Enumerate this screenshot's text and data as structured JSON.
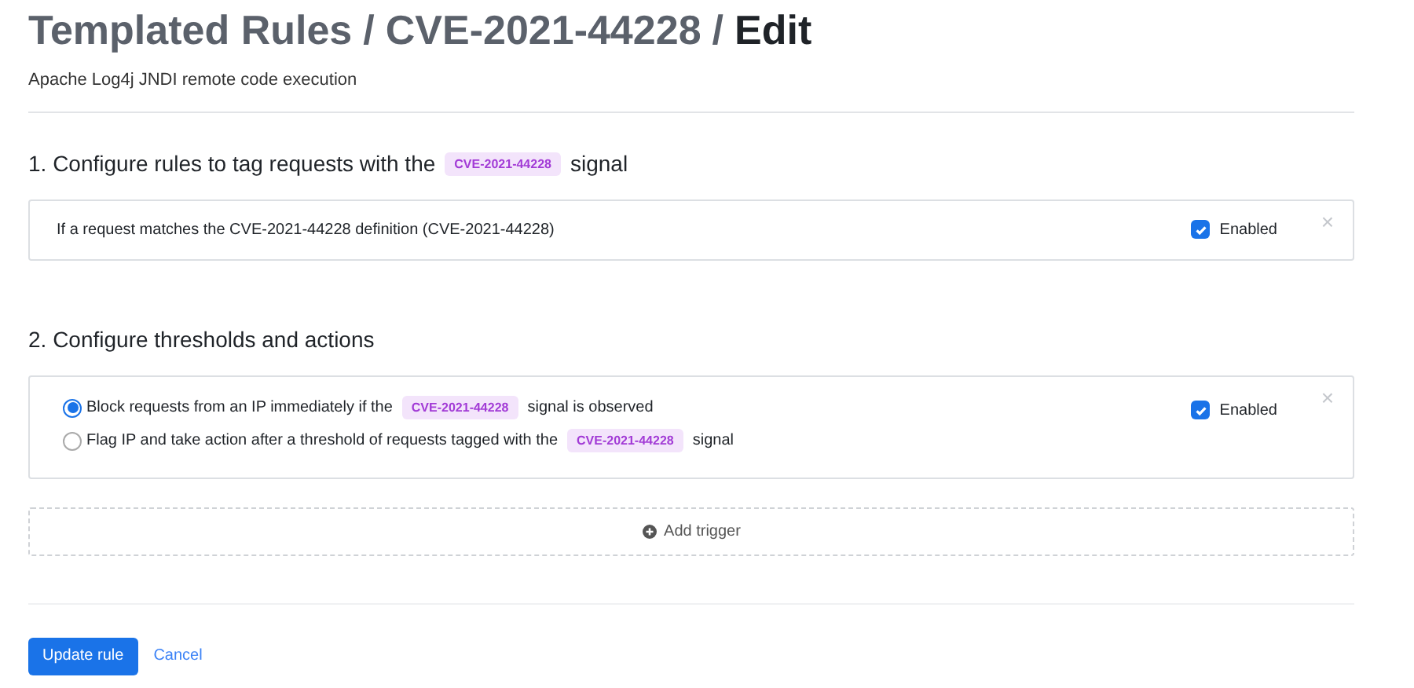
{
  "breadcrumb": [
    {
      "label": "Templated Rules",
      "kind": "link"
    },
    {
      "label": "/",
      "kind": "separator"
    },
    {
      "label": "CVE-2021-44228",
      "kind": "link"
    },
    {
      "label": "/",
      "kind": "separator"
    },
    {
      "label": "Edit",
      "kind": "current"
    }
  ],
  "subtitle": "Apache Log4j JNDI remote code execution",
  "sections": [
    {
      "heading": {
        "before": "1. Configure rules to tag requests with the",
        "tag": "CVE-2021-44228",
        "after": "signal"
      },
      "card": {
        "kind": "rule",
        "text": "If a request matches the CVE-2021-44228 definition (CVE-2021-44228)",
        "enabled": true,
        "enabled_label": "Enabled",
        "close": "×"
      }
    },
    {
      "heading": {
        "before": "2. Configure thresholds and actions"
      },
      "card": {
        "kind": "options",
        "options": [
          {
            "before": "Block requests from an IP immediately if the",
            "tag": "CVE-2021-44228",
            "after": "signal is observed",
            "selected": true
          },
          {
            "before": "Flag IP and take action after a threshold of requests tagged with the",
            "tag": "CVE-2021-44228",
            "after": "signal",
            "selected": false
          }
        ],
        "enabled": true,
        "enabled_label": "Enabled",
        "close": "×"
      },
      "add_trigger": "Add trigger"
    }
  ],
  "actions": {
    "primary": "Update rule",
    "secondary": "Cancel"
  }
}
